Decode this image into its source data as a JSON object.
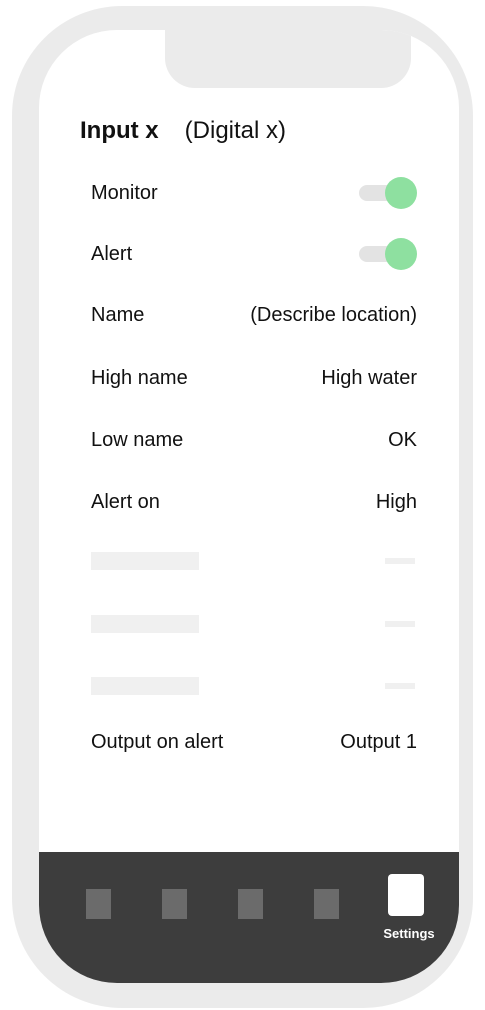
{
  "header": {
    "title": "Input x",
    "subtitle": "(Digital x)"
  },
  "settings": {
    "monitor": {
      "label": "Monitor",
      "enabled": true
    },
    "alert": {
      "label": "Alert",
      "enabled": true
    },
    "name": {
      "label": "Name",
      "value": "(Describe location)"
    },
    "high_name": {
      "label": "High name",
      "value": "High water"
    },
    "low_name": {
      "label": "Low name",
      "value": "OK"
    },
    "alert_on": {
      "label": "Alert on",
      "value": "High"
    },
    "output_on_alert": {
      "label": "Output on alert",
      "value": "Output 1"
    }
  },
  "tabbar": {
    "settings_label": "Settings",
    "active_tab": "Settings"
  },
  "colors": {
    "toggle_on": "#8ee0a0",
    "toggle_track": "#e3e3e3",
    "tabbar_bg": "#3d3d3d",
    "tab_inactive": "#6b6b6b",
    "frame": "#ebebeb"
  }
}
